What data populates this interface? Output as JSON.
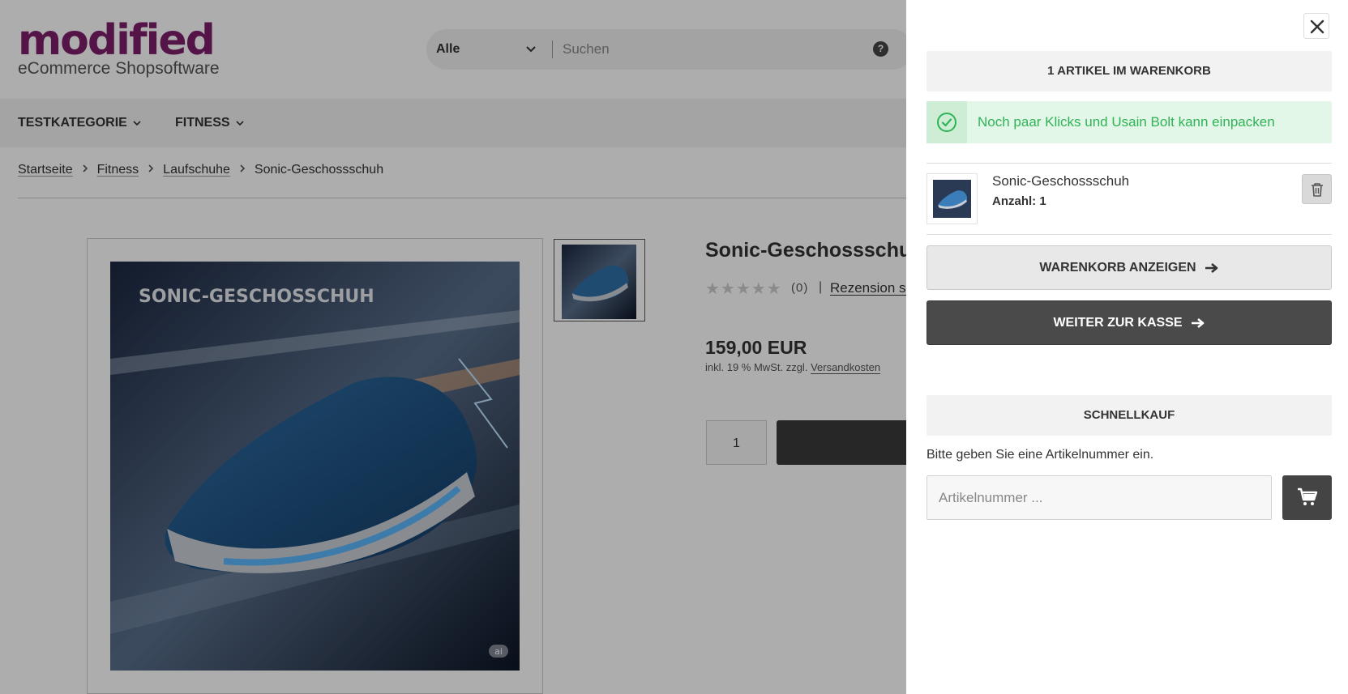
{
  "logo": {
    "main": "modified",
    "sub": "eCommerce Shopsoftware"
  },
  "search": {
    "category": "Alle",
    "placeholder": "Suchen",
    "help": "?"
  },
  "nav": {
    "items": [
      {
        "label": "TESTKATEGORIE"
      },
      {
        "label": "FITNESS"
      }
    ]
  },
  "breadcrumb": {
    "items": [
      "Startseite",
      "Fitness",
      "Laufschuhe",
      "Sonic-Geschossschuh"
    ]
  },
  "product": {
    "title": "Sonic-Geschossschuh",
    "image_text": "SONIC-GESCHOSSCHUH",
    "ai_badge": "ai",
    "stars": "★★★★★",
    "rating_value": 0,
    "review_count": "(0)",
    "review_separator": "|",
    "review_link": "Rezension schreiben",
    "price": "159,00 EUR",
    "tax_note": "inkl. 19 % MwSt. zzgl.",
    "shipping_link": "Versandkosten",
    "quantity": "1"
  },
  "cart_panel": {
    "count_label": "1 ARTIKEL IM WARENKORB",
    "alert_text": "Noch paar Klicks und Usain Bolt kann einpacken",
    "item": {
      "name": "Sonic-Geschossschuh",
      "qty_label": "Anzahl: 1"
    },
    "view_cart_label": "WARENKORB ANZEIGEN",
    "checkout_label": "WEITER ZUR KASSE",
    "quick_buy_title": "SCHNELLKAUF",
    "quick_buy_help": "Bitte geben Sie eine Artikelnummer ein.",
    "quick_buy_placeholder": "Artikelnummer ..."
  },
  "colors": {
    "brand": "#7d1e6a",
    "success": "#2fb356",
    "success_bg": "#e3f7e8",
    "dark_button": "#4a4a4a"
  },
  "icons": [
    "help-icon",
    "chevron-down-icon",
    "chevron-right-icon",
    "star-icon",
    "close-icon",
    "check-circle-icon",
    "trash-icon",
    "arrow-right-icon",
    "cart-icon"
  ]
}
